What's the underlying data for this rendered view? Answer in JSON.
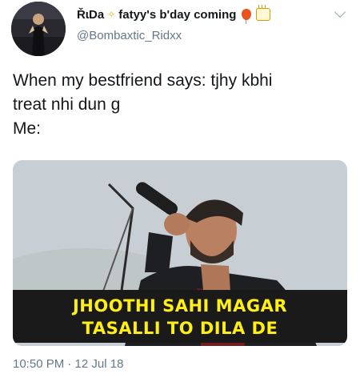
{
  "author": {
    "display_name": "ŘɩDa",
    "name_suffix": "fatyy's b'day coming",
    "handle": "@Bombaxtic_Ridxx"
  },
  "tweet": {
    "lines": [
      "When my bestfriend says: tjhy kbhi",
      "treat nhi dun g",
      "Me:"
    ],
    "timestamp": "10:50 PM · 12 Jul 18"
  },
  "media": {
    "caption_lines": [
      "JHOOTHI SAHI MAGAR",
      "TASALLI TO DILA DE"
    ]
  },
  "icons": {
    "deco": "sparkle-emoji",
    "balloon": "balloon-emoji",
    "cake": "birthday-cake-emoji",
    "menu": "chevron-down-icon"
  },
  "colors": {
    "secondary_text": "#657786",
    "caption_text": "#ffef17",
    "primary_text": "#14171a"
  }
}
